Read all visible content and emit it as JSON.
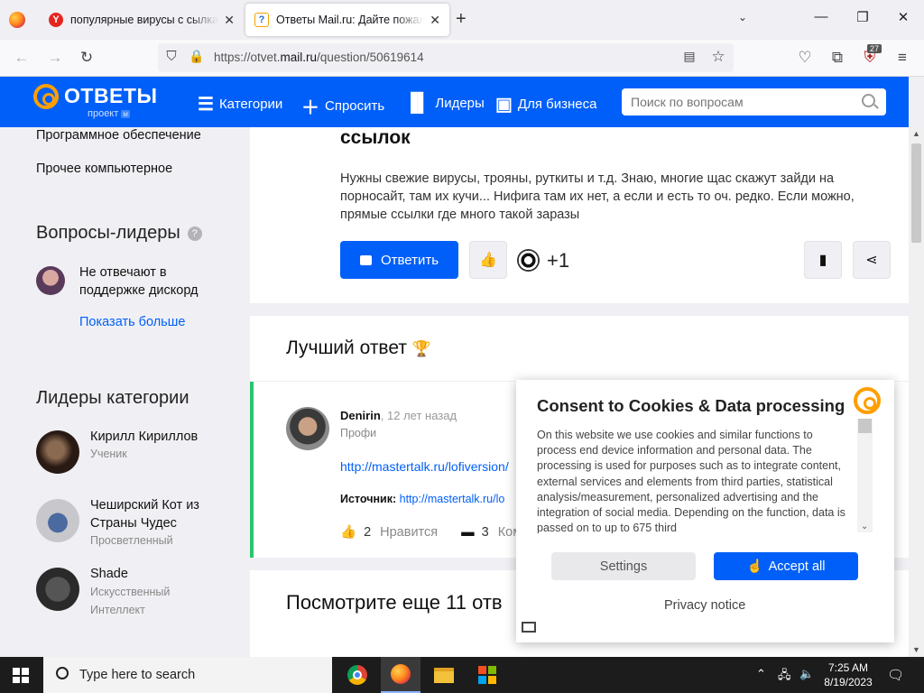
{
  "browser": {
    "tabs": [
      {
        "title": "популярные вирусы с сылкам",
        "favicon": "Y"
      },
      {
        "title": "Ответы Mail.ru: Дайте пожалуй",
        "favicon": "?"
      }
    ],
    "url_prefix": "https://otvet.",
    "url_domain": "mail.ru",
    "url_path": "/question/50619614",
    "extension_badge": "27"
  },
  "header": {
    "logo_text": "ОТВЕТЫ",
    "logo_sub": "проект",
    "logo_sub_badge": "м",
    "nav": [
      {
        "label": "Категории",
        "icon": "menu-icon"
      },
      {
        "label": "Спросить",
        "icon": "plus-icon"
      },
      {
        "label": "Лидеры",
        "icon": "bar-chart-icon"
      },
      {
        "label": "Для бизнеса",
        "icon": "briefcase-icon"
      }
    ],
    "search_placeholder": "Поиск по вопросам"
  },
  "sidebar": {
    "categories": [
      "Программное обеспечение",
      "Прочее компьютерное"
    ],
    "leader_questions_title": "Вопросы-лидеры",
    "help_glyph": "?",
    "leader_question": "Не отвечают в поддержке дискорд",
    "show_more": "Показать больше",
    "category_leaders_title": "Лидеры категории",
    "leaders": [
      {
        "name": "Кирилл Кириллов",
        "rank": "Ученик"
      },
      {
        "name": "Чеширский Кот из Страны Чудес",
        "rank": "Просветленный"
      },
      {
        "name": "Shade",
        "rank": "Искусственный Интеллект"
      }
    ]
  },
  "question": {
    "title_tail": "ссылок",
    "body": "Нужны свежие вирусы, трояны, руткиты и т.д. Знаю, многие щас скажут зайди на порносайт, там их кучи... Нифига там их нет, а если и есть то оч. редко. Если можно, прямые ссылки где много такой заразы",
    "answer_button": "Ответить",
    "likes": "+1"
  },
  "best_answer": {
    "title": "Лучший ответ",
    "author": "Denirin",
    "time": ", 12 лет назад",
    "rank": "Профи",
    "link": "http://mastertalk.ru/lofiversion/",
    "source_label": "Источник:",
    "source_link": "http://mastertalk.ru/lo",
    "likes_count": "2",
    "likes_label": "Нравится",
    "comments_count": "3",
    "comments_label": "Ком"
  },
  "more_answers_title": "Посмотрите еще 11 отв",
  "consent": {
    "title": "Consent to Cookies & Data processing",
    "text": "On this website we use cookies and similar functions to process end device information and personal data. The processing is used for purposes such as to integrate content, external services and elements from third parties, statistical analysis/measurement, personalized advertising and the integration of social media. Depending on the function, data is passed on to up to 675 third",
    "settings_button": "Settings",
    "accept_button": "Accept all",
    "privacy_link": "Privacy notice"
  },
  "taskbar": {
    "search_placeholder": "Type here to search",
    "time": "7:25 AM",
    "date": "8/19/2023"
  },
  "colors": {
    "brand_blue": "#005ff9",
    "accent_orange": "#ff9e00",
    "best_answer_green": "#2cc56f"
  }
}
